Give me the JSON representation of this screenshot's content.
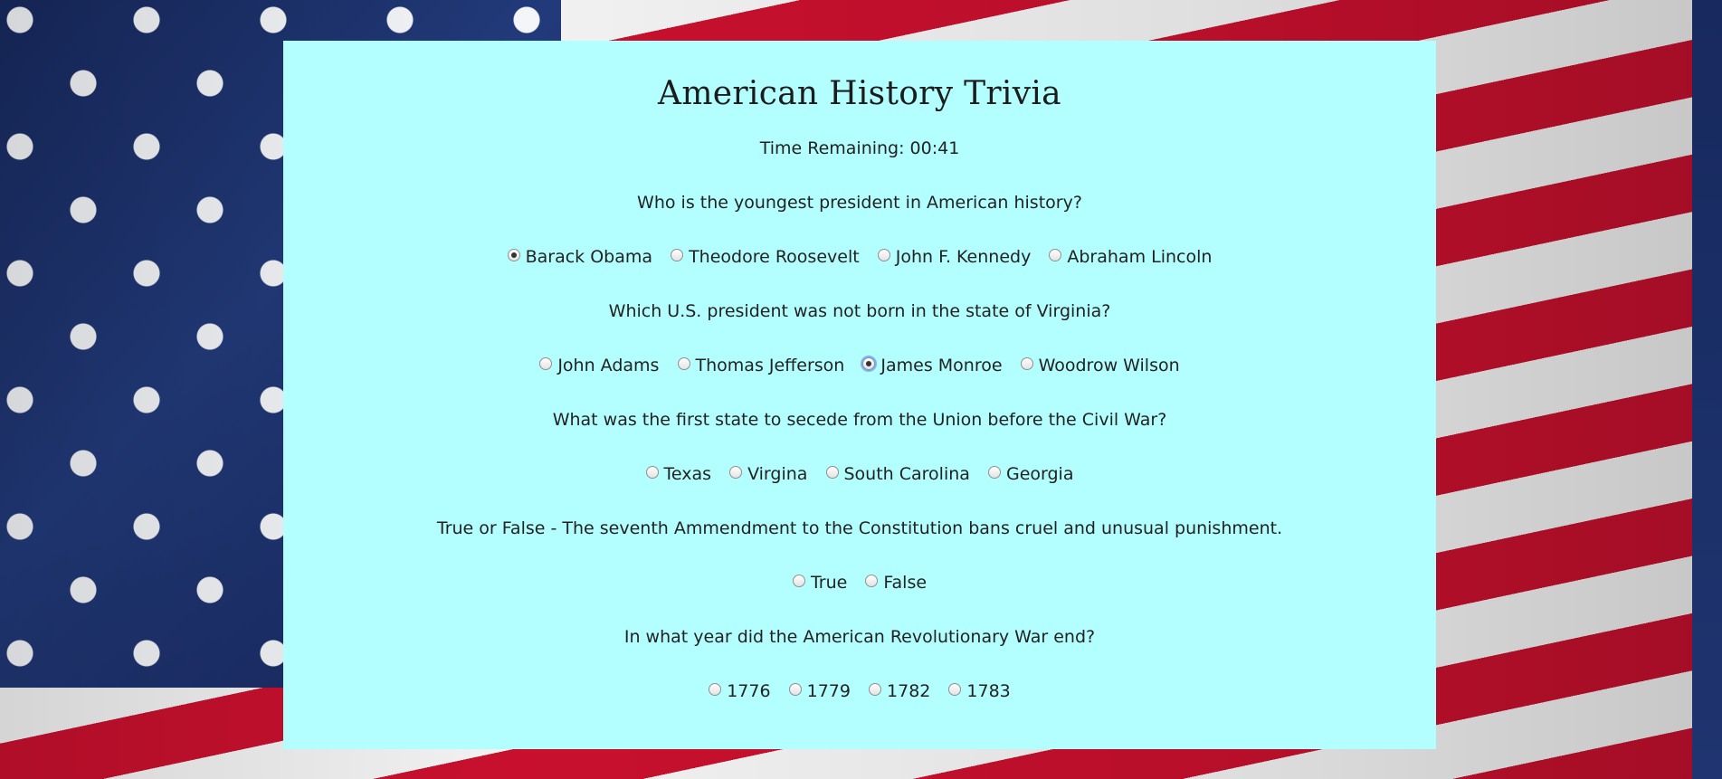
{
  "page": {
    "title": "American History Trivia",
    "timer_label": "Time Remaining: 00:41"
  },
  "colors": {
    "panel_background": "#b3ffff",
    "flag_red": "#c8102e",
    "flag_blue": "#1f3470",
    "flag_white": "#f2f2f2"
  },
  "questions": [
    {
      "text": "Who is the youngest president in American history?",
      "options": [
        "Barack Obama",
        "Theodore Roosevelt",
        "John F. Kennedy",
        "Abraham Lincoln"
      ],
      "selected": 0
    },
    {
      "text": "Which U.S. president was not born in the state of Virginia?",
      "options": [
        "John Adams",
        "Thomas Jefferson",
        "James Monroe",
        "Woodrow Wilson"
      ],
      "selected": 2
    },
    {
      "text": "What was the first state to secede from the Union before the Civil War?",
      "options": [
        "Texas",
        "Virgina",
        "South Carolina",
        "Georgia"
      ],
      "selected": null
    },
    {
      "text": "True or False - The seventh Ammendment to the Constitution bans cruel and unusual punishment.",
      "options": [
        "True",
        "False"
      ],
      "selected": null
    },
    {
      "text": "In what year did the American Revolutionary War end?",
      "options": [
        "1776",
        "1779",
        "1782",
        "1783"
      ],
      "selected": null
    }
  ]
}
